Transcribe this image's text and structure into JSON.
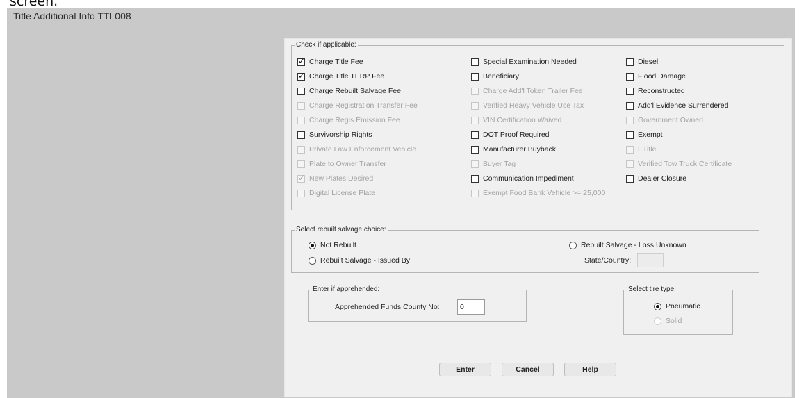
{
  "title_strip": "screen.",
  "window": {
    "title": "Title Additional Info TTL008"
  },
  "applicable": {
    "legend": "Check if applicable:",
    "items": [
      {
        "label": "Charge Title Fee",
        "checked": true,
        "enabled": true
      },
      {
        "label": "Charge Title TERP Fee",
        "checked": true,
        "enabled": true
      },
      {
        "label": "Charge Rebuilt Salvage Fee",
        "checked": false,
        "enabled": true
      },
      {
        "label": "Charge Registration Transfer Fee",
        "checked": false,
        "enabled": false
      },
      {
        "label": "Charge Regis Emission Fee",
        "checked": false,
        "enabled": false
      },
      {
        "label": "Survivorship Rights",
        "checked": false,
        "enabled": true
      },
      {
        "label": "Private Law Enforcement Vehicle",
        "checked": false,
        "enabled": false
      },
      {
        "label": "Plate to Owner Transfer",
        "checked": false,
        "enabled": false
      },
      {
        "label": "New Plates Desired",
        "checked": true,
        "enabled": false
      },
      {
        "label": "Digital License Plate",
        "checked": false,
        "enabled": false
      },
      {
        "label": "Special Examination Needed",
        "checked": false,
        "enabled": true
      },
      {
        "label": "Beneficiary",
        "checked": false,
        "enabled": true
      },
      {
        "label": "Charge Add'l Token Trailer Fee",
        "checked": false,
        "enabled": false
      },
      {
        "label": "Verified Heavy Vehicle Use Tax",
        "checked": false,
        "enabled": false
      },
      {
        "label": "VIN Certification Waived",
        "checked": false,
        "enabled": false
      },
      {
        "label": "DOT Proof Required",
        "checked": false,
        "enabled": true
      },
      {
        "label": "Manufacturer Buyback",
        "checked": false,
        "enabled": true
      },
      {
        "label": "Buyer Tag",
        "checked": false,
        "enabled": false
      },
      {
        "label": "Communication Impediment",
        "checked": false,
        "enabled": true
      },
      {
        "label": "Exempt Food Bank Vehicle >= 25,000",
        "checked": false,
        "enabled": false
      },
      {
        "label": "Diesel",
        "checked": false,
        "enabled": true
      },
      {
        "label": "Flood Damage",
        "checked": false,
        "enabled": true
      },
      {
        "label": "Reconstructed",
        "checked": false,
        "enabled": true
      },
      {
        "label": "Add'l Evidence Surrendered",
        "checked": false,
        "enabled": true
      },
      {
        "label": "Government Owned",
        "checked": false,
        "enabled": false
      },
      {
        "label": "Exempt",
        "checked": false,
        "enabled": true
      },
      {
        "label": "ETitle",
        "checked": false,
        "enabled": false
      },
      {
        "label": "Verified Tow Truck Certificate",
        "checked": false,
        "enabled": false
      },
      {
        "label": "Dealer Closure",
        "checked": false,
        "enabled": true
      }
    ]
  },
  "salvage": {
    "legend": "Select rebuilt salvage choice:",
    "options": [
      {
        "label": "Not Rebuilt",
        "selected": true
      },
      {
        "label": "Rebuilt Salvage - Issued By",
        "selected": false
      },
      {
        "label": "Rebuilt Salvage - Loss Unknown",
        "selected": false
      }
    ],
    "state_country_label": "State/Country:",
    "state_country_value": ""
  },
  "apprehended": {
    "legend": "Enter if apprehended:",
    "label": "Apprehended Funds County No:",
    "value": "0"
  },
  "tire": {
    "legend": "Select tire type:",
    "options": [
      {
        "label": "Pneumatic",
        "selected": true,
        "enabled": true
      },
      {
        "label": "Solid",
        "selected": false,
        "enabled": false
      }
    ]
  },
  "buttons": {
    "enter": "Enter",
    "cancel": "Cancel",
    "help": "Help"
  },
  "icons": {
    "check": "check-mark-icon",
    "radio": "radio-dot-icon"
  }
}
